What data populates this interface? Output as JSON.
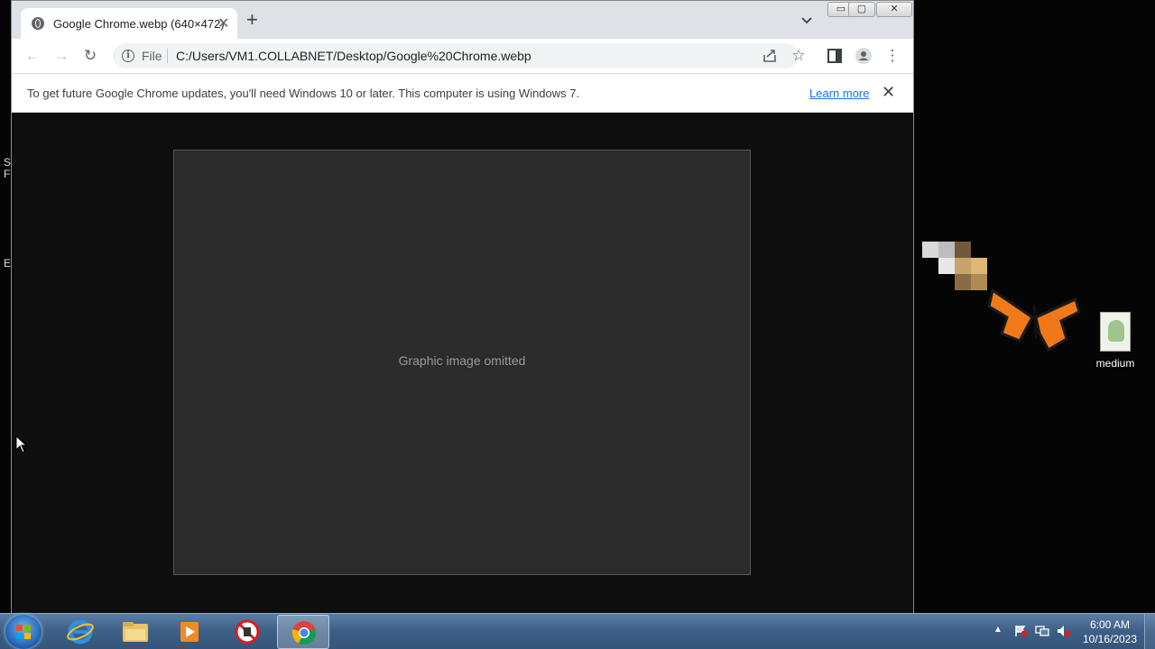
{
  "desktop": {
    "edge_text": [
      "S",
      "F",
      "E"
    ],
    "icon_label": "medium"
  },
  "browser": {
    "tab_title": "Google Chrome.webp (640×472)",
    "tab_close": "✕",
    "new_tab": "+",
    "address_scheme": "File",
    "address_url": "C:/Users/VM1.COLLABNET/Desktop/Google%20Chrome.webp",
    "window_controls": {
      "minimize": "▭",
      "maximize": "▢",
      "close": "✕"
    }
  },
  "infobar": {
    "message": "To get future Google Chrome updates, you'll need Windows 10 or later. This computer is using Windows 7.",
    "learn_more": "Learn more",
    "close": "✕"
  },
  "viewer": {
    "notice": "Graphic image omitted"
  },
  "taskbar": {
    "time": "6:00 AM",
    "date": "10/16/2023"
  },
  "colors": {
    "taskbar": "#3e5f85",
    "link": "#1a73e8",
    "viewer_bg": "#0e0e0e"
  }
}
